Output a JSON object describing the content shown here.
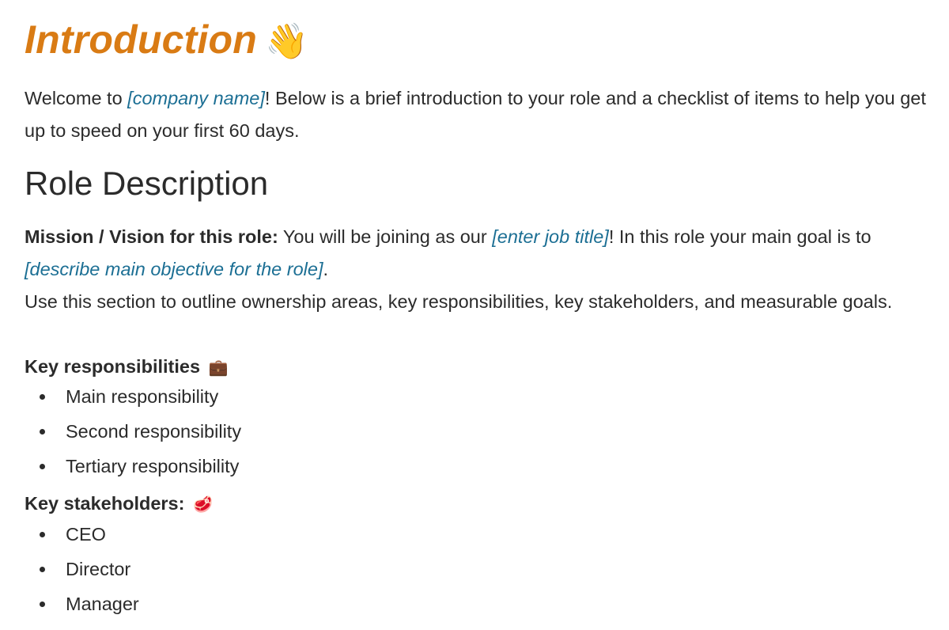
{
  "document": {
    "title": "Introduction",
    "title_emoji": "👋",
    "intro": {
      "prefix": "Welcome to ",
      "placeholder": "[company name]",
      "suffix": "! Below is a brief introduction to your role and a checklist of items to help you get up to speed on your first 60 days."
    },
    "role_heading": "Role Description",
    "mission": {
      "label": "Mission / Vision for this role:",
      "text_before": " You will be joining as our ",
      "job_title_placeholder": "[enter job title]",
      "text_after": "! In this role your main goal is to ",
      "objective_placeholder": "[describe main objective for the role]",
      "end": "."
    },
    "outline_text": "Use this section to outline ownership areas, key responsibilities, key stakeholders, and measurable goals.",
    "key_responsibilities": {
      "label": "Key responsibilities",
      "emoji": "💼",
      "items": [
        "Main responsibility",
        "Second responsibility",
        "Tertiary responsibility"
      ]
    },
    "key_stakeholders": {
      "label": "Key stakeholders:",
      "emoji": "🥩",
      "items": [
        "CEO",
        "Director",
        "Manager"
      ]
    }
  },
  "colors": {
    "title": "#d97b14",
    "placeholder_link": "#1c6f94",
    "body_text": "#2b2b2b"
  }
}
